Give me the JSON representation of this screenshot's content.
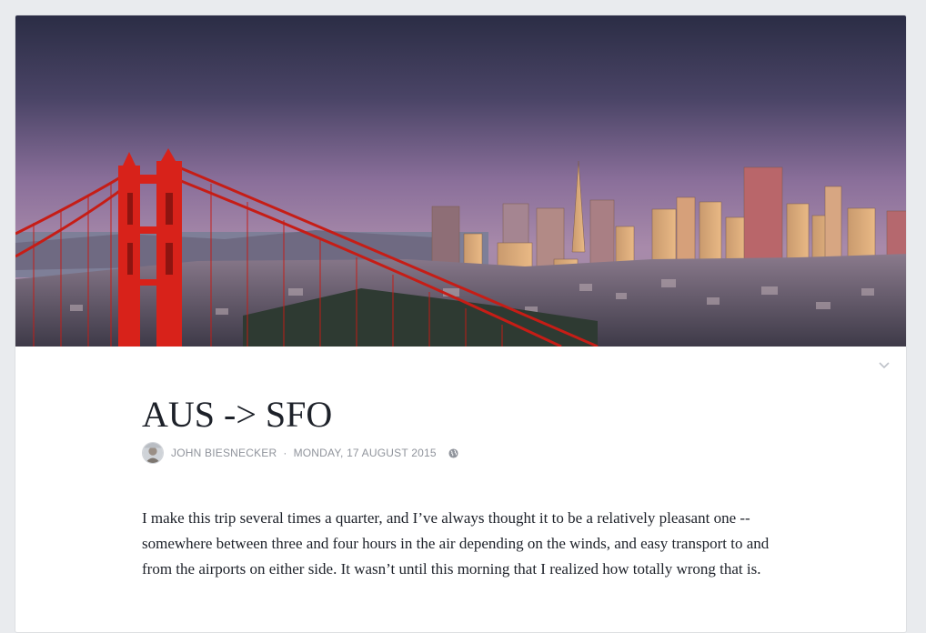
{
  "post": {
    "title": "AUS -> SFO",
    "author": "JOHN BIESNECKER",
    "separator": "·",
    "date": "MONDAY, 17 AUGUST 2015",
    "body": "I make this trip several times a quarter, and I’ve always thought it to be a relatively pleasant one -- somewhere between three and four hours in the air depending on the winds, and easy transport to and from the airports on either side. It wasn’t until this morning that I realized how totally wrong that is."
  },
  "icons": {
    "collapse": "chevron-down-icon",
    "privacy": "globe-icon",
    "avatar": "author-avatar"
  },
  "colors": {
    "page_background": "#e9ebee",
    "card": "#ffffff",
    "text": "#1d2129",
    "meta_text": "#90949c",
    "bridge": "#d8221a"
  }
}
